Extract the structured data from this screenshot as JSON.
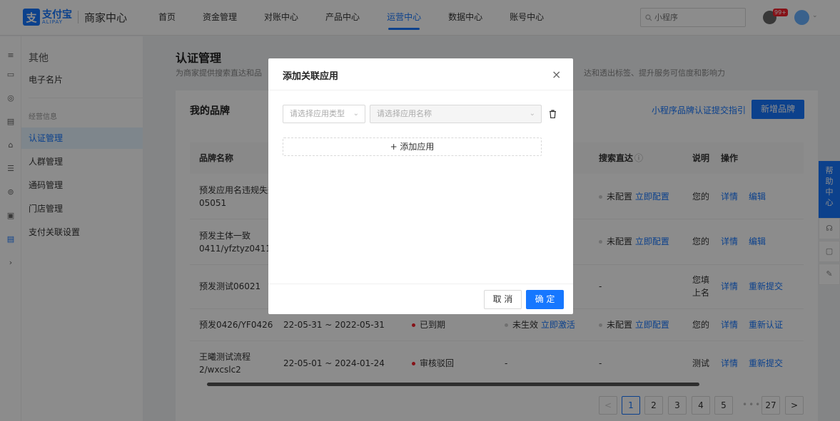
{
  "header": {
    "logo_icon": "alipay-logo-icon",
    "logo_cn": "支付宝",
    "logo_en": "ALIPAY",
    "app_title": "商家中心",
    "nav": [
      "首页",
      "资金管理",
      "对账中心",
      "产品中心",
      "运营中心",
      "数据中心",
      "账号中心"
    ],
    "active_nav": "运营中心",
    "search_placeholder": "小程序",
    "notification_badge": "99+",
    "brand_color": "#1677ff"
  },
  "sidebar": {
    "group_title": "其他",
    "item_card": "电子名片",
    "section_caption": "经营信息",
    "items": [
      "认证管理",
      "人群管理",
      "通码管理",
      "门店管理",
      "支付关联设置"
    ],
    "active_item": "认证管理"
  },
  "main": {
    "title": "认证管理",
    "desc_left": "为商家提供搜索直达和品",
    "desc_right": "达和透出标签、提升服务可信度和影响力",
    "card_title": "我的品牌",
    "guide_link": "小程序品牌认证提交指引",
    "add_brand_button": "新增品牌",
    "columns": {
      "brand_name": "品牌名称",
      "search_direct": "搜索直达",
      "description": "说明",
      "actions": "操作"
    },
    "rows": [
      {
        "name_line1": "预发应用名违规失效",
        "name_line2": "05051",
        "period": "",
        "status": "",
        "status_color": "",
        "activation": "",
        "activation_link": "",
        "search": "未配置",
        "search_link": "立即配置",
        "desc": "您的品",
        "action1": "详情",
        "action2": "编辑"
      },
      {
        "name_line1": "预发主体一致",
        "name_line2": "0411/yfztyz0411",
        "period": "",
        "status": "",
        "status_color": "",
        "activation": "",
        "activation_link": "",
        "search": "未配置",
        "search_link": "立即配置",
        "desc": "您的品",
        "action1": "详情",
        "action2": "编辑"
      },
      {
        "name_line1": "预发测试06021",
        "name_line2": "",
        "period": "",
        "status": "",
        "status_color": "",
        "activation": "",
        "activation_link": "",
        "search": "-",
        "search_link": "",
        "desc": "您填写",
        "desc2": "上名称",
        "action1": "详情",
        "action2": "重新提交"
      },
      {
        "name_line1": "预发0426/YF0426",
        "name_line2": "",
        "period": "22-05-31 ~ 2022-05-31",
        "status": "已到期",
        "status_color": "#f5222d",
        "activation": "未生效",
        "activation_link": "立即激活",
        "search": "未配置",
        "search_link": "立即配置",
        "desc": "您的品",
        "action1": "详情",
        "action2": "重新认证"
      },
      {
        "name_line1": "王曦测试流程",
        "name_line2": "2/wxcslc2",
        "period": "22-05-01 ~ 2024-01-24",
        "status": "审核驳回",
        "status_color": "#f5222d",
        "activation": "-",
        "activation_link": "",
        "search": "-",
        "search_link": "",
        "desc": "测试",
        "action1": "详情",
        "action2": "重新提交"
      }
    ],
    "pagination": {
      "pages": [
        "1",
        "2",
        "3",
        "4",
        "5"
      ],
      "current": "1",
      "last": "27",
      "prev": "<",
      "next": ">",
      "ellipsis": "•••"
    }
  },
  "help_panel": {
    "label": "帮助中心"
  },
  "modal": {
    "title": "添加关联应用",
    "close": "×",
    "type_placeholder": "请选择应用类型",
    "name_placeholder": "请选择应用名称",
    "add_app": "+ 添加应用",
    "cancel": "取 消",
    "ok": "确 定"
  }
}
